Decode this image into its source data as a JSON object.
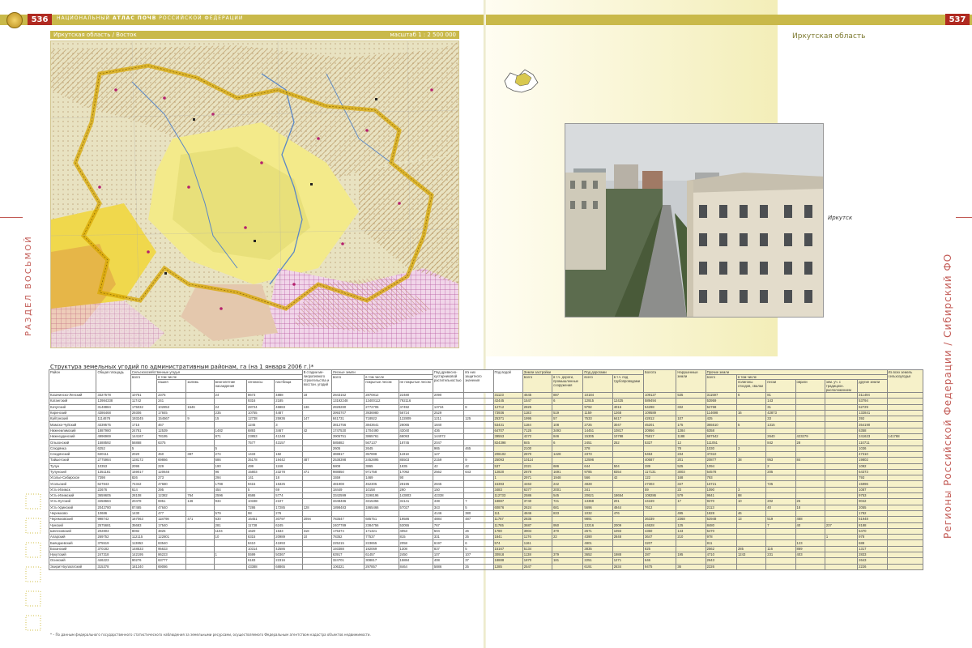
{
  "header": {
    "page_left": "536",
    "page_right": "537",
    "series_prefix": "НАЦИОНАЛЬНЫЙ",
    "series_bold": "АТЛАС ПОЧВ",
    "series_suffix": "РОССИЙСКОЙ ФЕДЕРАЦИИ"
  },
  "map": {
    "region_label": "Иркутская область / Восток",
    "scale": "масштаб 1 : 2 500 000",
    "city_labels": [
      "Киренск",
      "Мама",
      "Бодайбо",
      "Витим",
      "Нижнеудинск"
    ]
  },
  "side": {
    "left_text": "РАЗДЕЛ ВОСЬМОЙ",
    "right_text": "Регионы Российской Федерации / Сибирский ФО"
  },
  "right_page": {
    "region_title": "Иркутская область",
    "photo_caption": "Иркутск"
  },
  "colors": {
    "accent": "#c9b94a",
    "red": "#b02a21",
    "side_text": "#c25a55",
    "band": "#f6f1c9"
  },
  "table": {
    "title": "Структура земельных угодий по административным районам, га (на 1 января 2006 г.)*",
    "headers": [
      "Район",
      "Общая площадь",
      "всего",
      "пашня",
      "залежь",
      "многолетние насаждения",
      "сенокосы",
      "пастбища",
      "В стадии ме-лиоративного строительства и восстан. угодий",
      "всего",
      "покрытые лесом",
      "не покрытые лесом",
      "Под древесно-кустарниковой растительностью",
      "Из них защитного значения",
      "Под водой",
      "всего",
      "в т.ч. дороги, промышленные сооружения",
      "всего",
      "в т.ч. под трубопроводами",
      "Болота",
      "Нарушенные земли",
      "всего",
      "полигоны отходов, свалки",
      "пески",
      "овраги",
      "зем. уч. с традицион. расположением",
      "другие земли",
      "Из всех земель сельхозугодья"
    ],
    "group_headers": {
      "agri": "Сельскохозяйственные угодья",
      "agri_sub": "в том числе",
      "forest": "Лесные земли",
      "forest_sub": "в том числе",
      "built": "Земли застройки",
      "roads": "Под дорогами",
      "other": "Прочие земли",
      "other_sub": "в том числе"
    },
    "rows": [
      [
        "Казачинско-Ленский",
        "3327578",
        "10761",
        "2375",
        "",
        "24",
        "8673",
        "4888",
        "18",
        "2843152",
        "2870812",
        "22480",
        "2090",
        "",
        "31123",
        "4645",
        "887",
        "10184",
        "",
        "109127",
        "535",
        "311597",
        "6",
        "81",
        "",
        "",
        "311494",
        ""
      ],
      [
        "Катангский",
        "13984338",
        "11742",
        "241",
        "",
        "",
        "9316",
        "2185",
        "",
        "13192248",
        "13400112",
        "792116",
        "",
        "",
        "42445",
        "1547",
        "6",
        "12915",
        "12425",
        "589494",
        "",
        "53959",
        "",
        "143",
        "",
        "",
        "53794",
        ""
      ],
      [
        "Качугский",
        "3148884",
        "175032",
        "102853",
        "1546",
        "24",
        "28724",
        "46883",
        "136",
        "2828280",
        "2772706",
        "47492",
        "13734",
        "8",
        "12712",
        "2825",
        "",
        "9792",
        "4016",
        "54298",
        "332",
        "52768",
        "",
        "31",
        "",
        "",
        "52729",
        ""
      ],
      [
        "Киренский",
        "4386468",
        "29306",
        "17845",
        "",
        "235",
        "10755",
        "4487",
        "",
        "3993707",
        "3936980",
        "56724",
        "2529",
        "",
        "73936",
        "1183",
        "519",
        "1159",
        "1268",
        "109589",
        "",
        "114698",
        "16",
        "42873",
        "",
        "",
        "132841",
        ""
      ],
      [
        "Куйтунский",
        "1114676",
        "193245",
        "154567",
        "9",
        "15",
        "12738",
        "25936",
        "147",
        "841731",
        "718922",
        "122809",
        "1211",
        "125",
        "25371",
        "1995",
        "57",
        "7533",
        "6417",
        "42812",
        "107",
        "425",
        "",
        "33",
        "",
        "",
        "392",
        ""
      ],
      [
        "Мамско-Чуйский",
        "4339575",
        "1715",
        "467",
        "",
        "",
        "1245",
        "3",
        "",
        "3812756",
        "3843641",
        "28065",
        "1840",
        "",
        "53431",
        "1184",
        "108",
        "2725",
        "3047",
        "45201",
        "175",
        "355510",
        "5",
        "1315",
        "",
        "",
        "354190",
        ""
      ],
      [
        "Нижнеилимский",
        "1887980",
        "24781",
        "12539",
        "",
        "1482",
        "6893",
        "3467",
        "42",
        "1747530",
        "1704490",
        "43040",
        "436",
        "",
        "64707",
        "7125",
        "3493",
        "14451",
        "10817",
        "20956",
        "1284",
        "6358",
        "",
        "",
        "",
        "",
        "6358",
        ""
      ],
      [
        "Нижнеудинский",
        "4996969",
        "144167",
        "78195",
        "",
        "871",
        "23853",
        "41248",
        "",
        "3905751",
        "3865761",
        "68093",
        "144072",
        "",
        "39553",
        "4272",
        "846",
        "15305",
        "10788",
        "75817",
        "1188",
        "687542",
        "",
        "2640",
        "423279",
        "",
        "241623",
        "141788"
      ],
      [
        "Ольхонский",
        "1588592",
        "56868",
        "6375",
        "",
        "",
        "7577",
        "43157",
        "",
        "585882",
        "567137",
        "18745",
        "2047",
        "",
        "824398",
        "845",
        "6",
        "2451",
        "252",
        "5327",
        "12",
        "111051",
        "",
        "842",
        "28",
        "",
        "110711",
        ""
      ],
      [
        "Слюдянка",
        "6252",
        "5",
        "",
        "",
        "5",
        "",
        "",
        "",
        "2605",
        "2645",
        "",
        "965",
        "465",
        "",
        "2100",
        "",
        "378",
        "",
        "",
        "78",
        "1030",
        "3",
        "",
        "",
        "",
        "1036",
        ""
      ],
      [
        "Слюдянский",
        "630111",
        "2020",
        "450",
        "387",
        "274",
        "1433",
        "182",
        "",
        "369817",
        "357898",
        "11918",
        "127",
        "",
        "208102",
        "2870",
        "1428",
        "2373",
        "",
        "5453",
        "234",
        "47310",
        "",
        "",
        "",
        "",
        "47310",
        ""
      ],
      [
        "Тайшетский",
        "2775984",
        "128172",
        "69866",
        "",
        "686",
        "35178",
        "19442",
        "487",
        "2538398",
        "2452895",
        "85503",
        "2159",
        "9",
        "25093",
        "10114",
        "",
        "12596",
        "",
        "40687",
        "201",
        "20877",
        "38",
        "953",
        "84",
        "",
        "19802",
        ""
      ],
      [
        "Тулун",
        "10353",
        "2095",
        "229",
        "",
        "190",
        "499",
        "1166",
        "",
        "5808",
        "3865",
        "1935",
        "42",
        "42",
        "537",
        "2321",
        "686",
        "644",
        "504",
        "289",
        "525",
        "1094",
        "",
        "2",
        "",
        "",
        "1092",
        ""
      ],
      [
        "Тулунский",
        "1351181",
        "159017",
        "120646",
        "",
        "96",
        "15803",
        "23278",
        "471",
        "988850",
        "971758",
        "17092",
        "2562",
        "643",
        "12820",
        "2878",
        "1691",
        "9785",
        "8354",
        "117131",
        "3003",
        "54578",
        "",
        "205",
        "",
        "",
        "54373",
        ""
      ],
      [
        "Усолье-Сибирское",
        "7398",
        "826",
        "273",
        "",
        "294",
        "141",
        "18",
        "",
        "1559",
        "1469",
        "90",
        "",
        "",
        "1",
        "2971",
        "1948",
        "566",
        "42",
        "122",
        "168",
        "793",
        "",
        "",
        "",
        "",
        "793",
        ""
      ],
      [
        "Усольский",
        "627843",
        "74342",
        "47680",
        "",
        "1798",
        "9415",
        "15325",
        "",
        "481908",
        "452305",
        "28195",
        "2845",
        "",
        "15393",
        "4463",
        "242",
        "4828",
        "",
        "27303",
        "347",
        "16721",
        "",
        "725",
        "",
        "",
        "15996",
        ""
      ],
      [
        "Усть-Илимск",
        "22676",
        "614",
        "295",
        "",
        "454",
        "5",
        "69",
        "",
        "18449",
        "10158",
        "290",
        "150",
        "",
        "3483",
        "6377",
        "2001",
        "341",
        "",
        "59",
        "23",
        "1090",
        "3",
        "",
        "",
        "",
        "1087",
        ""
      ],
      [
        "Усть-Илимский",
        "3659605",
        "28108",
        "12382",
        "764",
        "2596",
        "6586",
        "5774",
        "",
        "3342599",
        "3198196",
        "143803",
        "42338",
        "",
        "112733",
        "2586",
        "545",
        "20621",
        "18654",
        "108286",
        "579",
        "9841",
        "88",
        "",
        "",
        "",
        "9753",
        ""
      ],
      [
        "Усть-Кутский",
        "3458684",
        "20478",
        "6951",
        "146",
        "934",
        "10338",
        "2107",
        "",
        "3348486",
        "3315355",
        "34141",
        "438",
        "7",
        "18887",
        "3740",
        "721",
        "13368",
        "201",
        "44169",
        "17",
        "9270",
        "10",
        "202",
        "25",
        "",
        "9042",
        ""
      ],
      [
        "Усть-Удинский",
        "2042780",
        "87465",
        "47640",
        "",
        "",
        "7286",
        "17285",
        "128",
        "1898483",
        "1865466",
        "57027",
        "343",
        "5",
        "60876",
        "2624",
        "681",
        "5696",
        "4944",
        "7612",
        "",
        "2113",
        "",
        "40",
        "18",
        "",
        "2055",
        ""
      ],
      [
        "Черемхово",
        "10686",
        "1430",
        "477",
        "",
        "579",
        "98",
        "276",
        "",
        "",
        "",
        "",
        "4146",
        "380",
        "111",
        "4846",
        "833",
        "1032",
        "476",
        "",
        "495",
        "1828",
        "46",
        "",
        "",
        "",
        "1782",
        ""
      ],
      [
        "Черемховский",
        "998742",
        "167063",
        "118798",
        "471",
        "630",
        "16451",
        "30797",
        "2094",
        "783547",
        "685751",
        "19586",
        "4884",
        "487",
        "11767",
        "2835",
        "",
        "9891",
        "",
        "36339",
        "2368",
        "52948",
        "13",
        "519",
        "468",
        "",
        "51948",
        ""
      ],
      [
        "Чунский",
        "2575681",
        "35683",
        "17540",
        "",
        "281",
        "11738",
        "6245",
        "",
        "2407789",
        "2384756",
        "53055",
        "767",
        "",
        "11765",
        "3687",
        "950",
        "13216",
        "2009",
        "44628",
        "125",
        "8480",
        "",
        "7",
        "40",
        "237",
        "8188",
        ""
      ],
      [
        "Шелеховский",
        "202803",
        "8082",
        "3825",
        "",
        "1104",
        "1620",
        "1533",
        "318",
        "175374",
        "171321",
        "4053",
        "504",
        "26",
        "1780",
        "3904",
        "370",
        "2671",
        "1093",
        "4350",
        "143",
        "5470",
        "",
        "",
        "",
        "",
        "5470",
        ""
      ],
      [
        "Аларский",
        "269752",
        "112115",
        "122801",
        "",
        "10",
        "6315",
        "20989",
        "10",
        "78352",
        "77537",
        "815",
        "331",
        "25",
        "1841",
        "1176",
        "22",
        "4390",
        "2848",
        "3647",
        "210",
        "978",
        "",
        "",
        "",
        "1",
        "978",
        ""
      ],
      [
        "Баяндаевский",
        "375519",
        "113853",
        "83540",
        "",
        "",
        "8410",
        "41993",
        "",
        "225215",
        "223655",
        "2058",
        "6197",
        "6",
        "574",
        "1161",
        "",
        "4801",
        "",
        "3207",
        "",
        "811",
        "",
        "",
        "123",
        "",
        "688",
        ""
      ],
      [
        "Боханский",
        "370182",
        "148533",
        "95633",
        "",
        "",
        "10314",
        "42586",
        "",
        "193388",
        "192069",
        "1308",
        "837",
        "5",
        "15167",
        "5134",
        "",
        "3835",
        "",
        "825",
        "",
        "2562",
        "285",
        "116",
        "869",
        "",
        "1317",
        ""
      ],
      [
        "Нукутский",
        "247318",
        "142195",
        "86223",
        "",
        "1",
        "5599",
        "50367",
        "",
        "63917",
        "61457",
        "2450",
        "107",
        "107",
        "30918",
        "1138",
        "379",
        "3652",
        "1988",
        "287",
        "195",
        "4710",
        "1243",
        "231",
        "403",
        "",
        "2833",
        ""
      ],
      [
        "Осинский",
        "446223",
        "90276",
        "63777",
        "",
        "",
        "6183",
        "22316",
        "",
        "324701",
        "308817",
        "15884",
        "408",
        "37",
        "18888",
        "1870",
        "181",
        "2251",
        "1271",
        "646",
        "",
        "2643",
        "",
        "",
        "",
        "",
        "2643",
        ""
      ],
      [
        "Эхирит-Булагатский",
        "315378",
        "181340",
        "69086",
        "",
        "",
        "43388",
        "68865",
        "",
        "106321",
        "297857",
        "8464",
        "5886",
        "25",
        "1285",
        "2547",
        "",
        "6191",
        "2634",
        "9475",
        "36",
        "2226",
        "",
        "",
        "",
        "",
        "2226",
        ""
      ]
    ]
  },
  "footnote": "* – По данным федерального государственного статистического наблюдения за земельными ресурсами, осуществляемого Федеральным агентством кадастра объектов недвижимости."
}
